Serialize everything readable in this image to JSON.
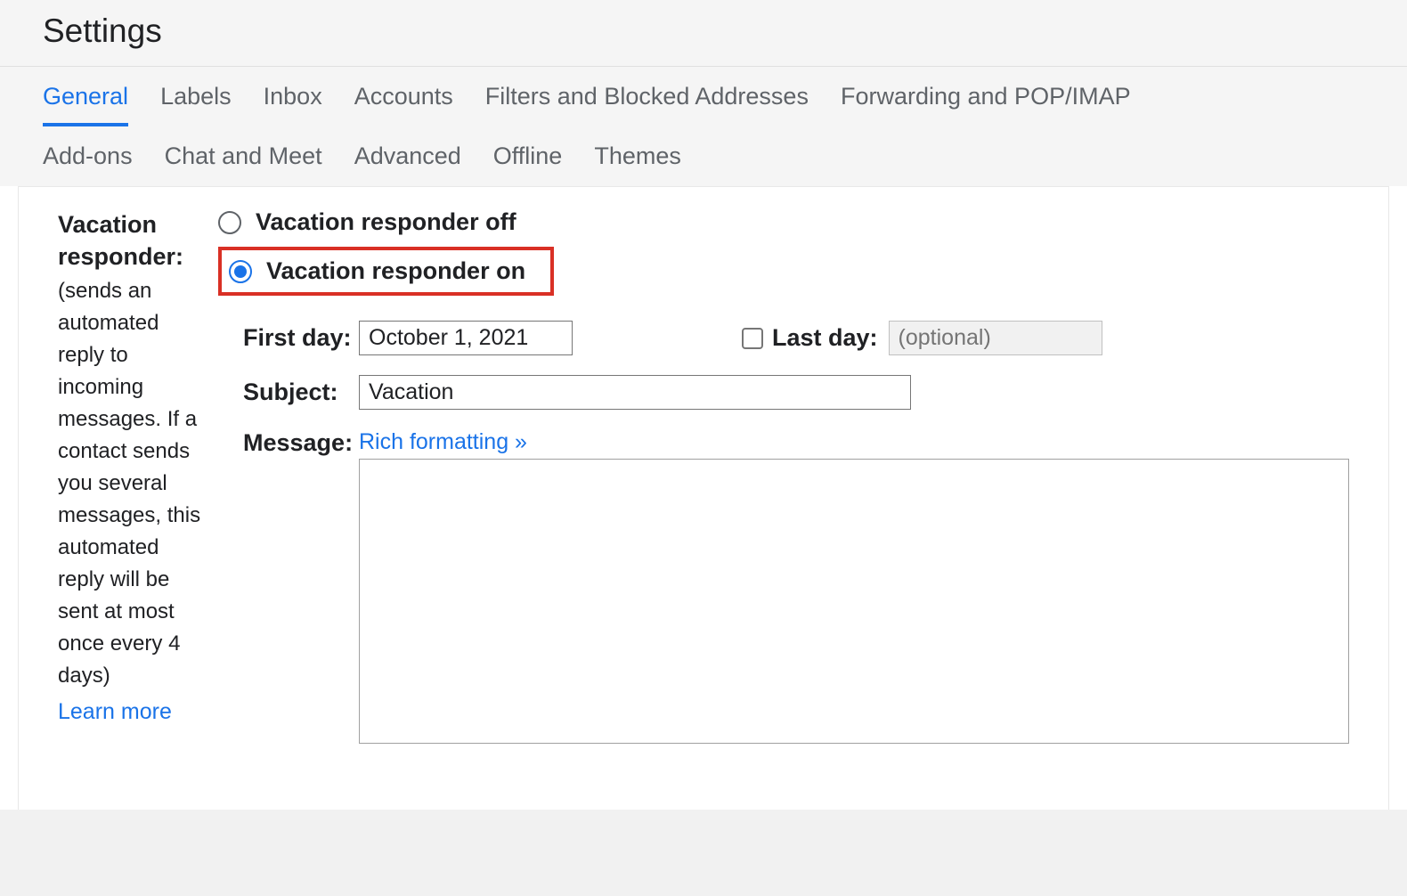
{
  "header": {
    "title": "Settings"
  },
  "tabs": {
    "row1": [
      {
        "label": "General",
        "active": true
      },
      {
        "label": "Labels",
        "active": false
      },
      {
        "label": "Inbox",
        "active": false
      },
      {
        "label": "Accounts",
        "active": false
      },
      {
        "label": "Filters and Blocked Addresses",
        "active": false
      },
      {
        "label": "Forwarding and POP/IMAP",
        "active": false
      }
    ],
    "row2": [
      {
        "label": "Add-ons",
        "active": false
      },
      {
        "label": "Chat and Meet",
        "active": false
      },
      {
        "label": "Advanced",
        "active": false
      },
      {
        "label": "Offline",
        "active": false
      },
      {
        "label": "Themes",
        "active": false
      }
    ]
  },
  "sidebar": {
    "title": "Vacation responder:",
    "description": "(sends an automated reply to incoming messages. If a contact sends you several messages, this automated reply will be sent at most once every 4 days)",
    "learn_more": "Learn more"
  },
  "radios": {
    "off_label": "Vacation responder off",
    "on_label": "Vacation responder on",
    "selected": "on"
  },
  "form": {
    "first_day_label": "First day:",
    "first_day_value": "October 1, 2021",
    "last_day_label": "Last day:",
    "last_day_placeholder": "(optional)",
    "last_day_checked": false,
    "subject_label": "Subject:",
    "subject_value": "Vacation",
    "message_label": "Message:",
    "rich_formatting_label": "Rich formatting »",
    "message_value": ""
  }
}
